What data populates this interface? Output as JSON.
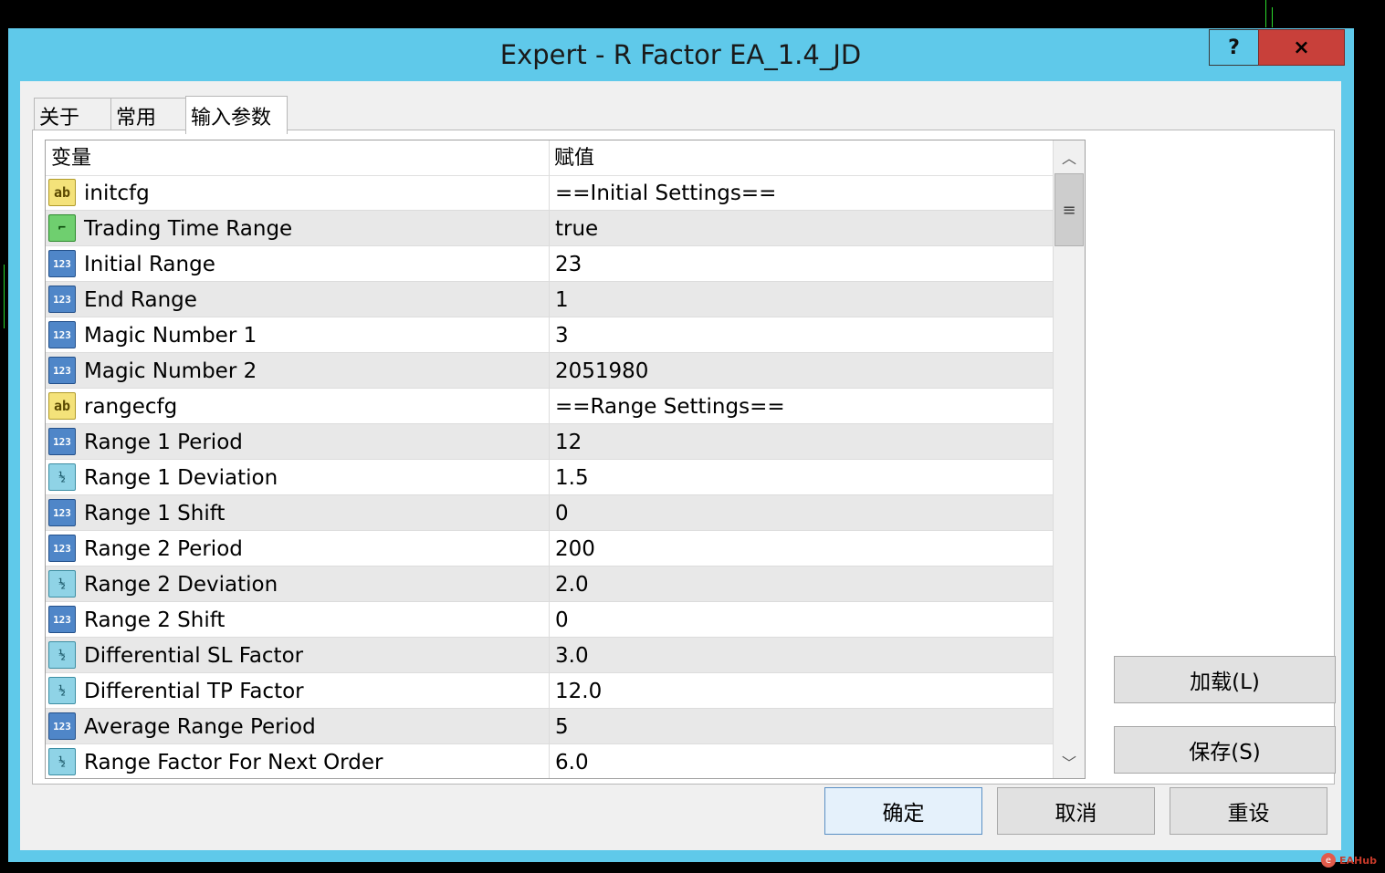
{
  "window": {
    "title": "Expert - R Factor EA_1.4_JD",
    "help_label": "?",
    "close_label": "×"
  },
  "tabs": [
    {
      "label": "关于"
    },
    {
      "label": "常用"
    },
    {
      "label": "输入参数"
    }
  ],
  "grid": {
    "headers": {
      "variable": "变量",
      "value": "赋值"
    },
    "rows": [
      {
        "icon": "ab",
        "name": "initcfg",
        "value": "==Initial Settings=="
      },
      {
        "icon": "bool",
        "name": "Trading Time Range",
        "value": "true"
      },
      {
        "icon": "int",
        "name": "Initial Range",
        "value": "23"
      },
      {
        "icon": "int",
        "name": "End Range",
        "value": "1"
      },
      {
        "icon": "int",
        "name": "Magic Number 1",
        "value": "3"
      },
      {
        "icon": "int",
        "name": "Magic Number 2",
        "value": "2051980"
      },
      {
        "icon": "ab",
        "name": "rangecfg",
        "value": "==Range Settings=="
      },
      {
        "icon": "int",
        "name": "Range 1 Period",
        "value": "12"
      },
      {
        "icon": "dbl",
        "name": "Range 1 Deviation",
        "value": "1.5"
      },
      {
        "icon": "int",
        "name": "Range 1 Shift",
        "value": "0"
      },
      {
        "icon": "int",
        "name": "Range 2 Period",
        "value": "200"
      },
      {
        "icon": "dbl",
        "name": "Range 2 Deviation",
        "value": "2.0"
      },
      {
        "icon": "int",
        "name": "Range 2 Shift",
        "value": "0"
      },
      {
        "icon": "dbl",
        "name": "Differential SL Factor",
        "value": "3.0"
      },
      {
        "icon": "dbl",
        "name": "Differential TP Factor",
        "value": "12.0"
      },
      {
        "icon": "int",
        "name": "Average Range Period",
        "value": "5"
      },
      {
        "icon": "dbl",
        "name": "Range Factor For Next Order",
        "value": "6.0"
      }
    ]
  },
  "icon_glyphs": {
    "ab": "ab",
    "int": "123",
    "dbl": "½",
    "bool": "⌐"
  },
  "buttons": {
    "load": "加载(L)",
    "save": "保存(S)",
    "ok": "确定",
    "cancel": "取消",
    "reset": "重设"
  },
  "watermark": {
    "text": "EAHub"
  }
}
